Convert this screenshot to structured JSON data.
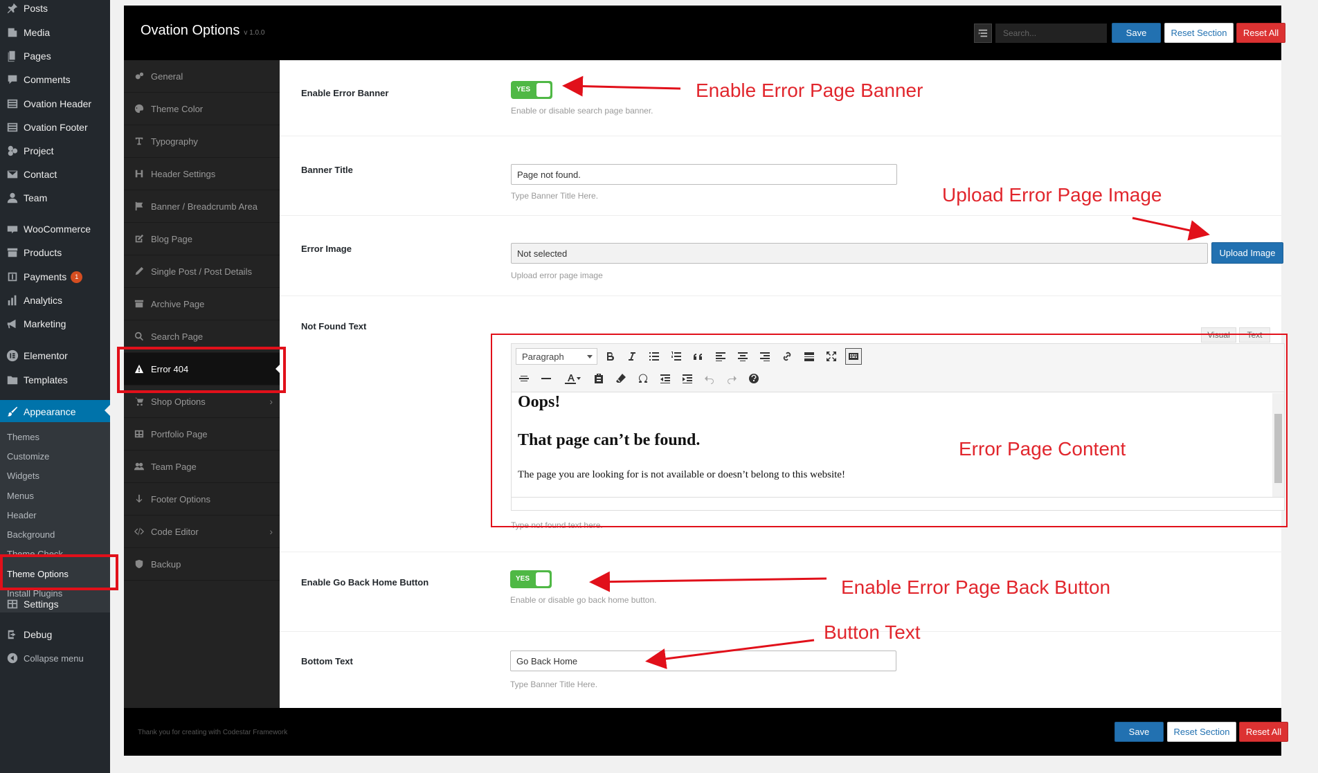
{
  "wp_menu": {
    "items": [
      {
        "label": "Posts",
        "icon": "pin-icon"
      },
      {
        "label": "Media",
        "icon": "media-icon"
      },
      {
        "label": "Pages",
        "icon": "pages-icon"
      },
      {
        "label": "Comments",
        "icon": "comments-icon"
      },
      {
        "label": "Ovation Header",
        "icon": "grid-icon"
      },
      {
        "label": "Ovation Footer",
        "icon": "grid-icon"
      },
      {
        "label": "Project",
        "icon": "project-icon"
      },
      {
        "label": "Contact",
        "icon": "mail-icon"
      },
      {
        "label": "Team",
        "icon": "user-icon"
      },
      {
        "label": "WooCommerce",
        "icon": "woo-icon"
      },
      {
        "label": "Products",
        "icon": "archive-icon"
      },
      {
        "label": "Payments",
        "icon": "payments-icon",
        "badge": "1"
      },
      {
        "label": "Analytics",
        "icon": "chart-icon"
      },
      {
        "label": "Marketing",
        "icon": "megaphone-icon"
      },
      {
        "label": "Elementor",
        "icon": "elementor-icon"
      },
      {
        "label": "Templates",
        "icon": "folder-icon"
      },
      {
        "label": "Appearance",
        "icon": "brush-icon",
        "active": true
      },
      {
        "label": "Settings",
        "icon": "settings-icon"
      },
      {
        "label": "Debug",
        "icon": "debug-icon"
      },
      {
        "label": "Collapse menu",
        "icon": "collapse-icon"
      }
    ],
    "submenu": [
      "Themes",
      "Customize",
      "Widgets",
      "Menus",
      "Header",
      "Background",
      "Theme Check",
      "Theme Options",
      "Install Plugins"
    ]
  },
  "header": {
    "title": "Ovation Options",
    "version": "v 1.0.0",
    "search_placeholder": "Search...",
    "save_label": "Save",
    "reset_section_label": "Reset Section",
    "reset_all_label": "Reset All"
  },
  "nav": {
    "items": [
      {
        "label": "General",
        "icon": "cogs-icon"
      },
      {
        "label": "Theme Color",
        "icon": "palette-icon"
      },
      {
        "label": "Typography",
        "icon": "text-icon"
      },
      {
        "label": "Header Settings",
        "icon": "heading-icon"
      },
      {
        "label": "Banner / Breadcrumb Area",
        "icon": "flag-icon"
      },
      {
        "label": "Blog Page",
        "icon": "edit-icon"
      },
      {
        "label": "Single Post / Post Details",
        "icon": "pencil-icon"
      },
      {
        "label": "Archive Page",
        "icon": "archive-icon"
      },
      {
        "label": "Search Page",
        "icon": "search-icon"
      },
      {
        "label": "Error 404",
        "icon": "warning-icon",
        "active": true
      },
      {
        "label": "Shop Options",
        "icon": "cart-icon",
        "has_children": true
      },
      {
        "label": "Portfolio Page",
        "icon": "table-icon"
      },
      {
        "label": "Team Page",
        "icon": "users-icon"
      },
      {
        "label": "Footer Options",
        "icon": "arrow-down-icon"
      },
      {
        "label": "Code Editor",
        "icon": "code-icon",
        "has_children": true
      },
      {
        "label": "Backup",
        "icon": "shield-icon"
      }
    ]
  },
  "fields": {
    "enable_banner": {
      "title": "Enable Error Banner",
      "switch_label": "YES",
      "desc": "Enable or disable search page banner."
    },
    "banner_title": {
      "title": "Banner Title",
      "value": "Page not found.",
      "desc": "Type Banner Title Here."
    },
    "error_image": {
      "title": "Error Image",
      "value": "Not selected",
      "button": "Upload Image",
      "desc": "Upload error page image"
    },
    "not_found_text": {
      "title": "Not Found Text",
      "tab_visual": "Visual",
      "tab_text": "Text",
      "format_select": "Paragraph",
      "heading1": "Oops!",
      "heading2": "That page can’t be found.",
      "paragraph": "The page you are looking for is not available or doesn’t belong to this website!",
      "desc": "Type not found text here."
    },
    "enable_back_button": {
      "title": "Enable Go Back Home Button",
      "switch_label": "YES",
      "desc": "Enable or disable go back home button."
    },
    "bottom_text": {
      "title": "Bottom Text",
      "value": "Go Back Home",
      "desc": "Type Banner Title Here."
    }
  },
  "footer": {
    "text": "Thank you for creating with Codestar Framework",
    "save_label": "Save",
    "reset_section_label": "Reset Section",
    "reset_all_label": "Reset All"
  },
  "annotations": {
    "banner": "Enable Error Page Banner",
    "upload": "Upload Error Page Image",
    "content": "Error Page Content",
    "back_button": "Enable Error Page Back Button",
    "button_text": "Button Text"
  },
  "colors": {
    "wp_sidebar": "#23282d",
    "wp_active": "#0073aa",
    "switch_on": "#4fb845",
    "save_blue": "#2271b1",
    "reset_red": "#dc3232",
    "annotation_red": "#e1262d"
  }
}
